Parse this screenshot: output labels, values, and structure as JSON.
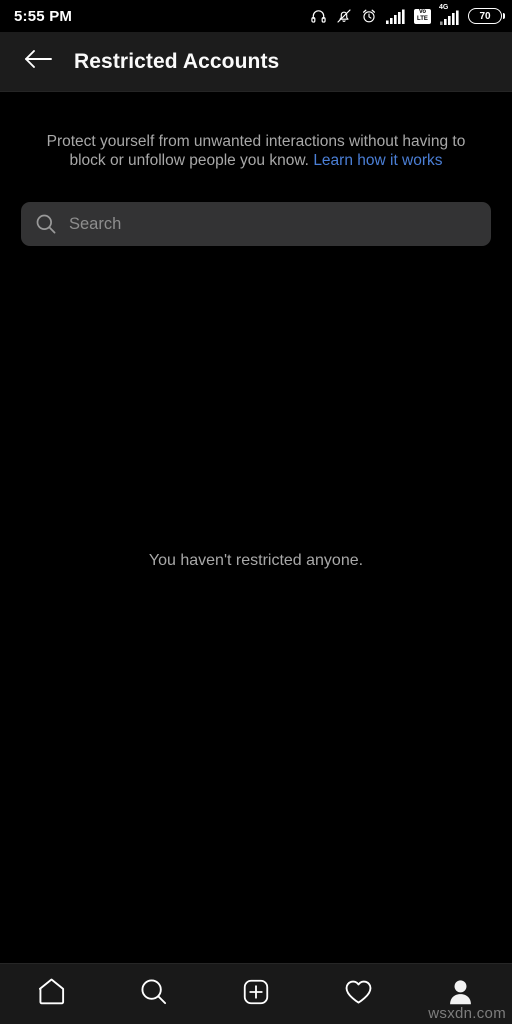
{
  "status_bar": {
    "time": "5:55 PM",
    "icons": [
      {
        "name": "headphones-icon"
      },
      {
        "name": "bell-muted-icon"
      },
      {
        "name": "alarm-clock-icon"
      },
      {
        "name": "signal-bars-icon"
      },
      {
        "name": "volte-badge-icon"
      },
      {
        "name": "signal-bars-4g-icon"
      },
      {
        "name": "battery-icon"
      }
    ],
    "volte_top": "Vo",
    "volte_bottom": "LTE",
    "network_label": "4G",
    "battery_level": "70"
  },
  "header": {
    "back_icon": "arrow-left-icon",
    "title": "Restricted Accounts"
  },
  "main": {
    "description_text": "Protect yourself from unwanted interactions without having to block or unfollow people you know. ",
    "description_link": "Learn how it works",
    "search": {
      "icon": "search-icon",
      "placeholder": "Search",
      "value": ""
    },
    "empty_state": "You haven't restricted anyone."
  },
  "bottom_nav": {
    "items": [
      {
        "name": "nav-home",
        "icon": "home-icon",
        "active": false
      },
      {
        "name": "nav-search",
        "icon": "search-icon",
        "active": false
      },
      {
        "name": "nav-create",
        "icon": "plus-square-icon",
        "active": false
      },
      {
        "name": "nav-activity",
        "icon": "heart-icon",
        "active": false
      },
      {
        "name": "nav-profile",
        "icon": "person-filled-icon",
        "active": true
      }
    ]
  },
  "watermark": "wsxdn.com",
  "colors": {
    "background": "#000000",
    "header_bg": "#1c1c1c",
    "nav_bg": "#191919",
    "search_bg": "#333334",
    "link": "#4b7fd6",
    "secondary_text": "#a8a8a8",
    "primary_text": "#fafafa"
  }
}
